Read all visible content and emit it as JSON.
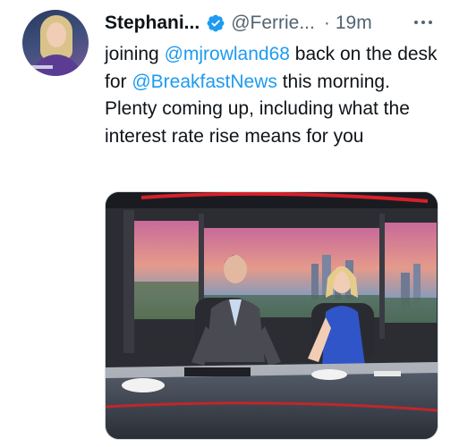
{
  "tweet": {
    "author_name": "Stephani...",
    "handle": "@Ferrie...",
    "separator": "·",
    "time": "19m",
    "text_parts": {
      "t1": "joining ",
      "m1": "@mjrowland68",
      "t2": " back on the desk for ",
      "m2": "@BreakfastNews",
      "t3": " this morning. Plenty coming up, including what the interest rate rise means for you"
    }
  },
  "icons": {
    "verified": "verified-badge-icon",
    "more": "more-options-icon"
  },
  "colors": {
    "link": "#1d9bf0",
    "verified": "#1d9bf0",
    "secondary_text": "#536471",
    "primary_text": "#0f1419"
  }
}
